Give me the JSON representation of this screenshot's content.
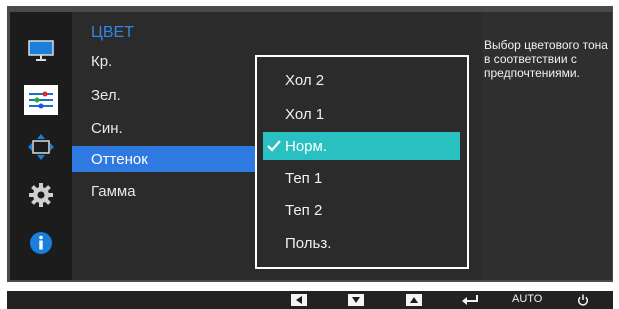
{
  "menu": {
    "title": "ЦВЕТ",
    "items": [
      {
        "label": "Кр."
      },
      {
        "label": "Зел."
      },
      {
        "label": "Син."
      },
      {
        "label": "Оттенок"
      },
      {
        "label": "Гамма"
      }
    ]
  },
  "dropdown": {
    "options": [
      {
        "label": "Хол 2"
      },
      {
        "label": "Хол 1"
      },
      {
        "label": "Норм."
      },
      {
        "label": "Теп 1"
      },
      {
        "label": "Теп 2"
      },
      {
        "label": "Польз."
      }
    ]
  },
  "description": "Выбор цветового тона в соответствии с предпочтениями.",
  "bottom_bar": {
    "auto_label": "AUTO"
  },
  "colors": {
    "selected_menu": "#2f7ae0",
    "selected_option": "#28c0c0",
    "title": "#2f87e6"
  }
}
